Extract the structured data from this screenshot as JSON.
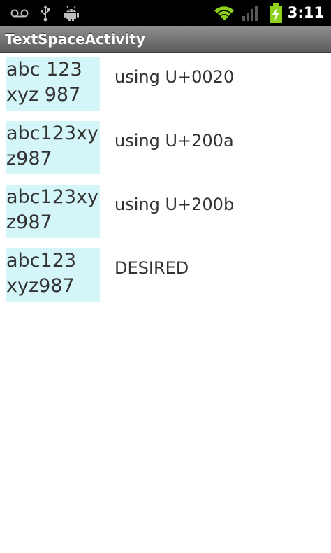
{
  "status_bar": {
    "time": "3:11",
    "icons": [
      "voicemail-icon",
      "usb-icon",
      "android-debug-icon",
      "wifi-icon",
      "signal-icon",
      "battery-charging-icon"
    ],
    "accent_green": "#8ed11c"
  },
  "app": {
    "title": "TextSpaceActivity"
  },
  "rows": [
    {
      "sample": "abc 123\nxyz 987",
      "caption": "using U+0020"
    },
    {
      "sample": "abc123xy\nz987",
      "caption": "using U+200a"
    },
    {
      "sample": "abc123xy\nz987",
      "caption": "using U+200b"
    },
    {
      "sample": "abc123\nxyz987",
      "caption": "DESIRED"
    }
  ],
  "colors": {
    "sample_background": "#d4f6f8",
    "text": "#333333"
  }
}
